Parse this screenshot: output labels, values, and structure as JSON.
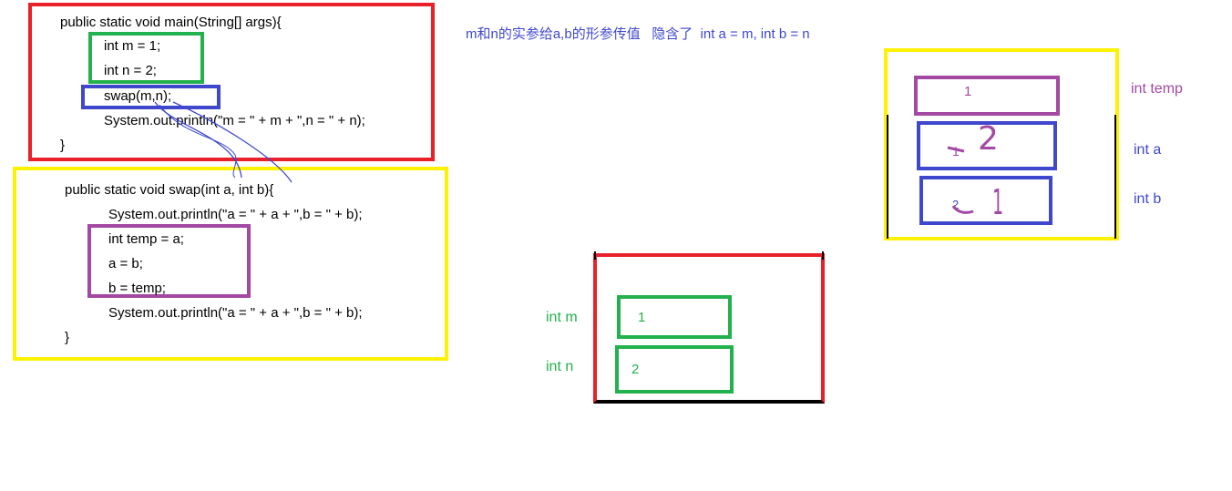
{
  "main_method": {
    "signature": "public static void main(String[] args){",
    "line_m": "int m = 1;",
    "line_n": "int n = 2;",
    "line_swap": "swap(m,n);",
    "line_print": "System.out.println(\"m = \" + m + \",n = \" + n);",
    "close": "}"
  },
  "swap_method": {
    "signature": "public static void swap(int a, int b){",
    "line_print1": "System.out.println(\"a = \" + a + \",b = \" + b);",
    "line_temp": "int temp = a;",
    "line_a": "a = b;",
    "line_b": "b = temp;",
    "line_print2": "System.out.println(\"a = \" + a + \",b = \" + b);",
    "close": "}"
  },
  "annotation": "m和n的实参给a,b的形参传值   隐含了  int a = m, int b = n",
  "main_stack": {
    "label_m": "int m",
    "value_m": "1",
    "label_n": "int n",
    "value_n": "2"
  },
  "swap_stack": {
    "label_temp": "int temp",
    "value_temp": "1",
    "label_a": "int a",
    "value_a_old": "1",
    "value_a_new": "2",
    "label_b": "int b",
    "value_b_old": "2",
    "value_b_new": "1"
  },
  "colors": {
    "red": "#e8202a",
    "yellow": "#fff200",
    "green": "#22b14c",
    "blue": "#3f48cc",
    "purple": "#a349a4",
    "label_blue": "#3f48cc",
    "label_green": "#22b14c"
  }
}
